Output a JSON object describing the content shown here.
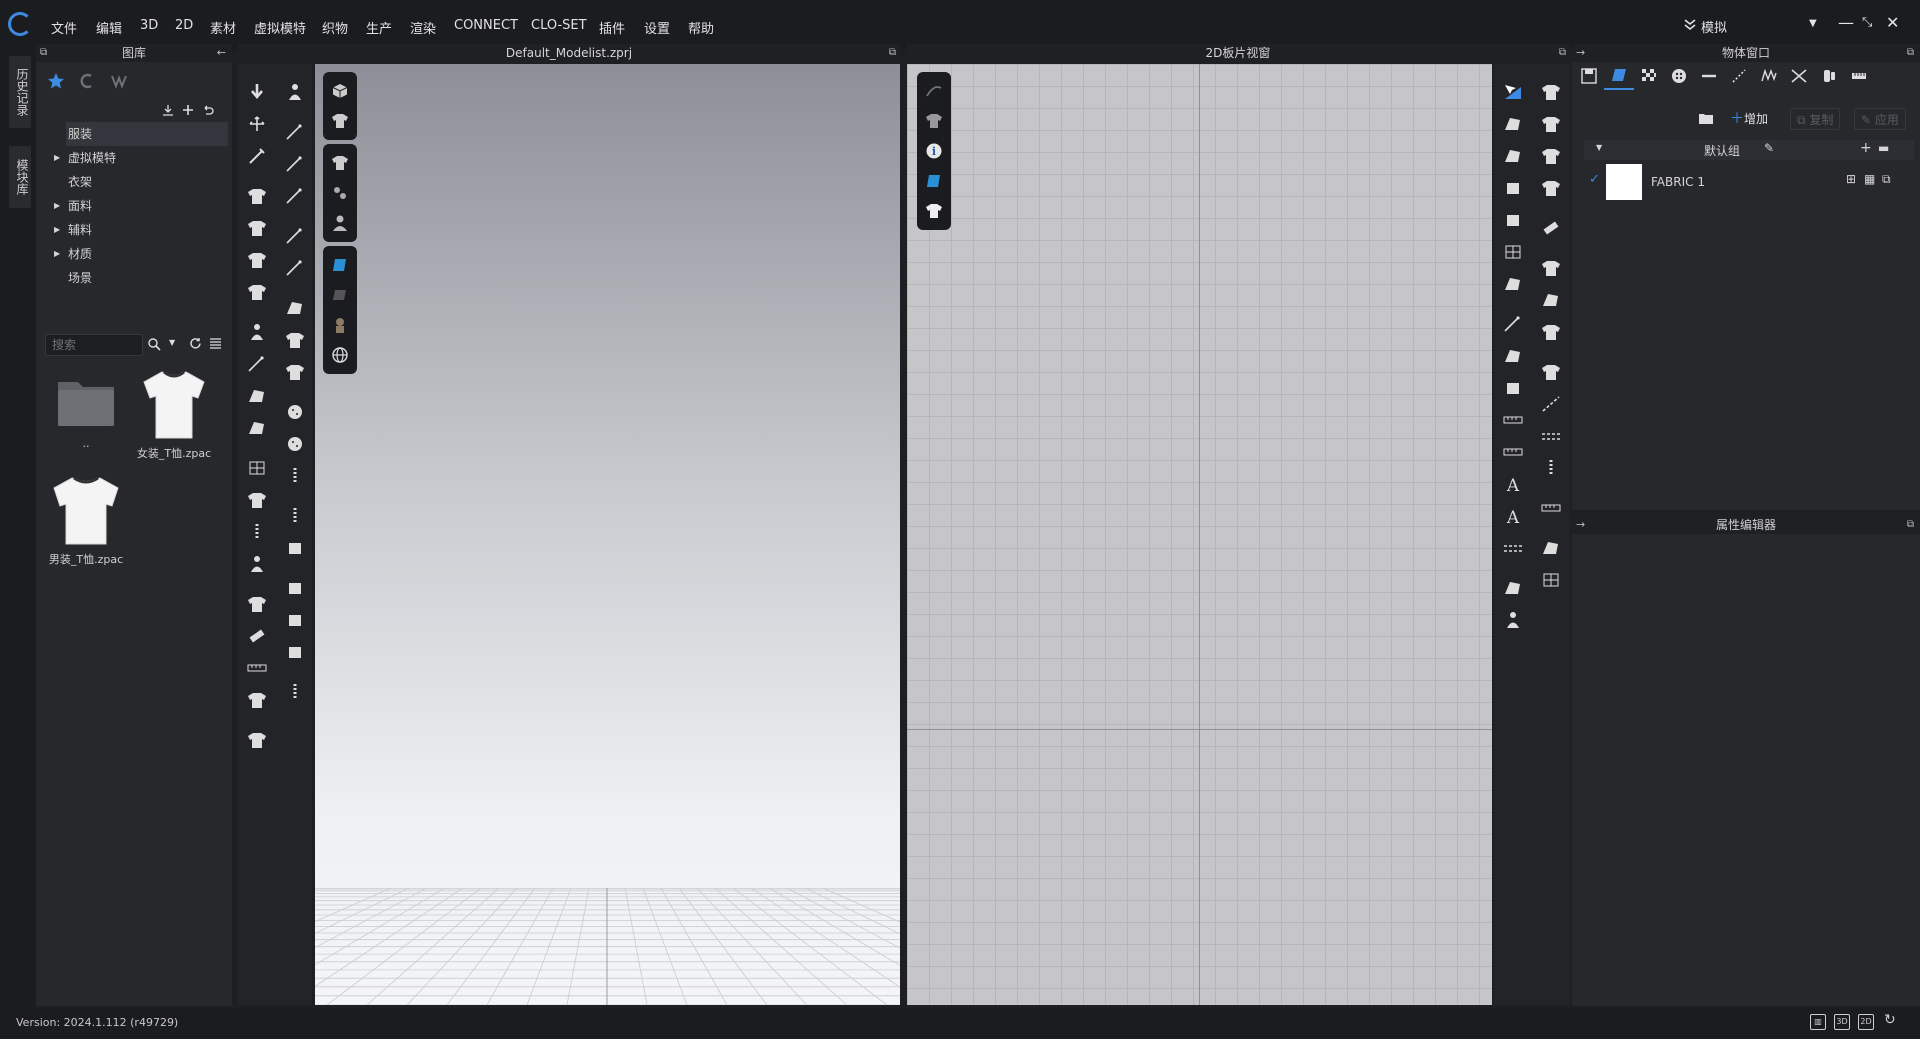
{
  "menu": [
    "文件",
    "编辑",
    "3D",
    "2D",
    "素材",
    "虚拟模特",
    "织物",
    "生产",
    "渲染",
    "CONNECT",
    "CLO-SET",
    "插件",
    "设置",
    "帮助"
  ],
  "mode": {
    "label": "模拟"
  },
  "side_tabs": [
    "历史记录",
    "模块库"
  ],
  "library": {
    "title": "图库",
    "tree": [
      {
        "label": "服装",
        "expandable": false,
        "selected": true
      },
      {
        "label": "虚拟模特",
        "expandable": true
      },
      {
        "label": "衣架",
        "expandable": false
      },
      {
        "label": "面料",
        "expandable": true
      },
      {
        "label": "辅料",
        "expandable": true
      },
      {
        "label": "材质",
        "expandable": true
      },
      {
        "label": "场景",
        "expandable": false
      }
    ],
    "search_placeholder": "搜索",
    "files": [
      {
        "name": "..",
        "icon": "folder-icon"
      },
      {
        "name": "女装_T恤.zpac",
        "icon": "tshirt-icon"
      },
      {
        "name": "男装_T恤.zpac",
        "icon": "tshirt-icon"
      }
    ]
  },
  "viewport3d": {
    "title": "Default_Modelist.zprj"
  },
  "viewport2d": {
    "title": "2D板片视窗"
  },
  "object_window": {
    "title": "物体窗口",
    "add_label": "增加",
    "copy_label": "复制",
    "apply_label": "应用",
    "group_label": "默认组",
    "fabrics": [
      {
        "name": "FABRIC 1",
        "checked": true,
        "swatch": "#ffffff"
      }
    ]
  },
  "property_editor": {
    "title": "属性编辑器"
  },
  "status": {
    "version": "Version: 2024.1.112 (r49729)"
  },
  "colors": {
    "accent": "#3d8be0",
    "background": "#1e1f22",
    "panel": "#27282c"
  }
}
